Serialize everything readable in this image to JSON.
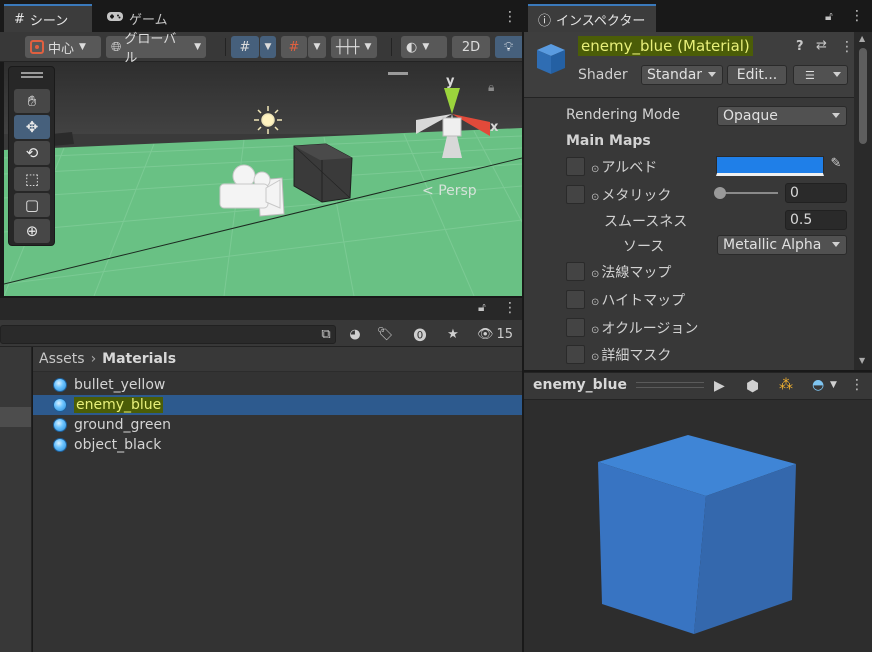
{
  "colors": {
    "accent": "#3a79bb",
    "selection": "#2d5a8e",
    "highlight": "#4b5d07",
    "albedo_swatch": "#1f7fe8",
    "ground": "#69c184",
    "cube_blue": "#3a78c8"
  },
  "scene_window": {
    "tabs": [
      {
        "label": "シーン",
        "icon": "grid-icon"
      },
      {
        "label": "ゲーム",
        "icon": "gamepad-icon"
      }
    ],
    "toolbar": {
      "pivot_label": "中心",
      "space_label": "グローバル",
      "mode_2d_label": "2D"
    },
    "gizmo": {
      "y_label": "y",
      "x_label": "x",
      "projection_label": "Persp"
    },
    "tools": [
      "hand-tool",
      "move-tool",
      "rotate-tool",
      "scale-tool",
      "rect-tool",
      "transform-tool"
    ]
  },
  "project_window": {
    "hidden_count": "15",
    "breadcrumb": {
      "root": "Assets",
      "current": "Materials"
    },
    "files": [
      {
        "name": "bullet_yellow",
        "selected": false
      },
      {
        "name": "enemy_blue",
        "selected": true
      },
      {
        "name": "ground_green",
        "selected": false
      },
      {
        "name": "object_black",
        "selected": false
      }
    ]
  },
  "inspector": {
    "tab_label": "インスペクター",
    "asset_title": "enemy_blue (Material)",
    "shader_label": "Shader",
    "shader_value": "Standar",
    "edit_button": "Edit...",
    "rendering_mode": {
      "label": "Rendering Mode",
      "value": "Opaque"
    },
    "section_title": "Main Maps",
    "albedo": {
      "label": "アルベド"
    },
    "metallic": {
      "label": "メタリック",
      "value": "0",
      "slider": 0.0
    },
    "smoothness": {
      "label": "スムースネス",
      "value": "0.5"
    },
    "source": {
      "label": "ソース",
      "value": "Metallic Alpha"
    },
    "maps": [
      {
        "label": "法線マップ"
      },
      {
        "label": "ハイトマップ"
      },
      {
        "label": "オクルージョン"
      },
      {
        "label": "詳細マスク"
      }
    ]
  },
  "preview": {
    "title": "enemy_blue"
  }
}
